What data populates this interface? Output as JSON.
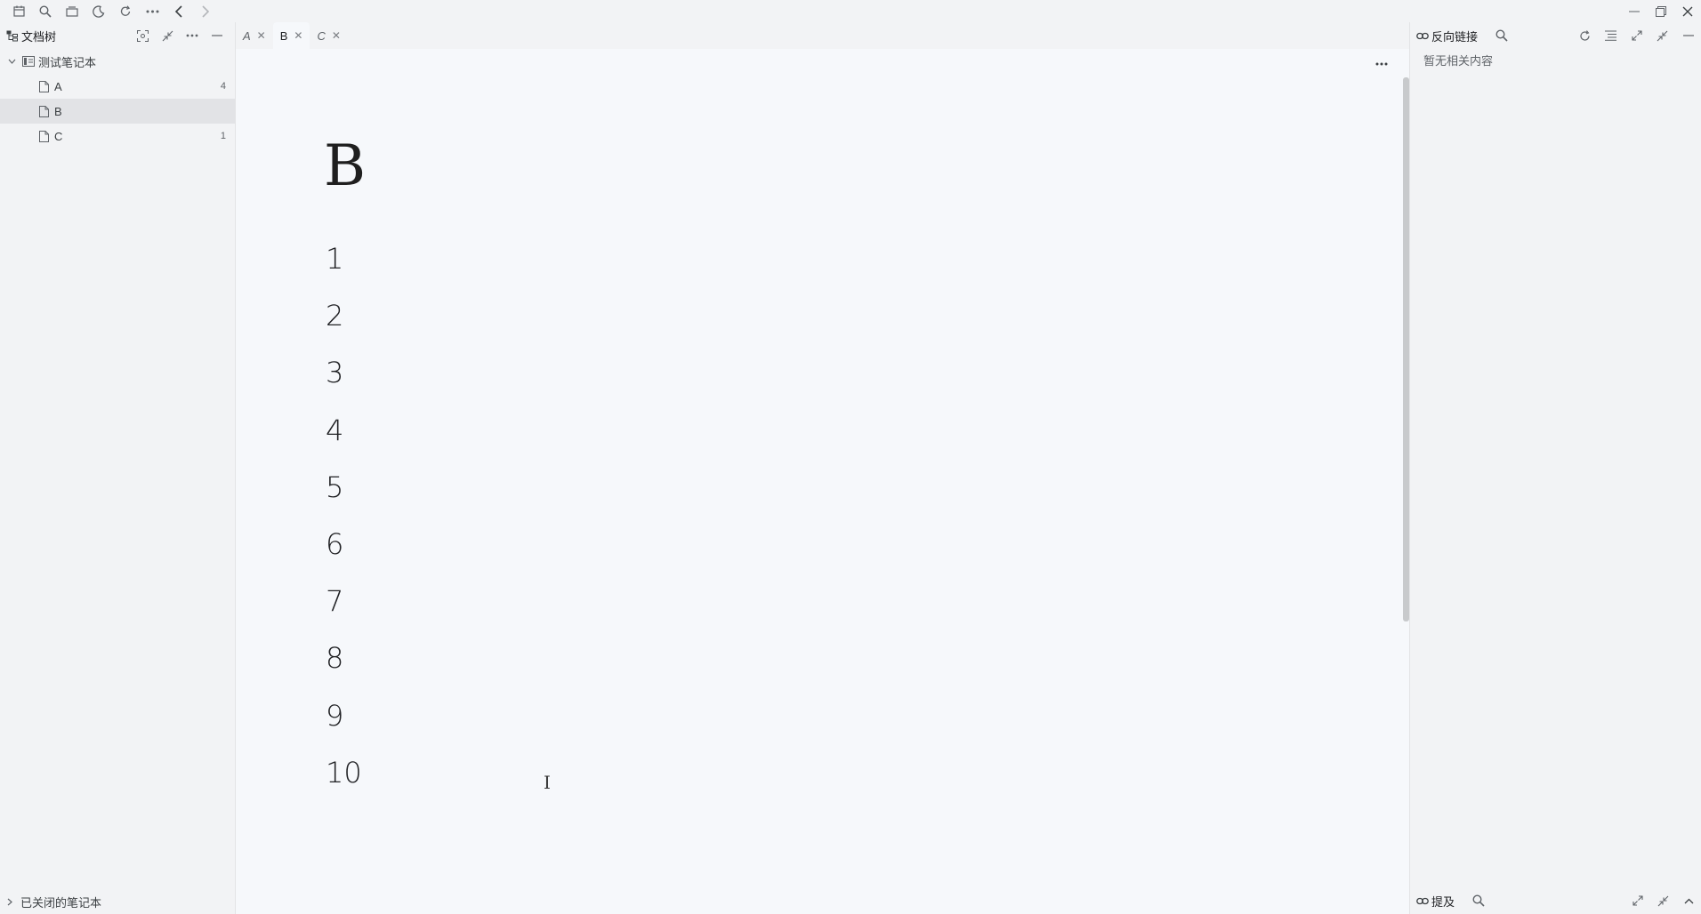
{
  "toolbar": {
    "left_icons": [
      "calendar-icon",
      "search-icon",
      "window-icon",
      "moon-icon",
      "sync-icon",
      "more-icon",
      "back-icon",
      "forward-icon"
    ],
    "right_icons": [
      "minimize-icon",
      "restore-icon",
      "close-icon"
    ]
  },
  "left_dock": {
    "title": "文档树",
    "notebook": {
      "name": "测试笔记本"
    },
    "docs": [
      {
        "name": "A",
        "count": "4"
      },
      {
        "name": "B",
        "count": ""
      },
      {
        "name": "C",
        "count": "1"
      }
    ],
    "closed_notebooks": "已关闭的笔记本"
  },
  "tabs": [
    {
      "label": "A"
    },
    {
      "label": "B"
    },
    {
      "label": "C"
    }
  ],
  "editor": {
    "title": "B",
    "paragraphs": [
      "1",
      "2",
      "3",
      "4",
      "5",
      "6",
      "7",
      "8",
      "9",
      "10"
    ]
  },
  "right_dock": {
    "backlinks_label": "反向链接",
    "empty_text": "暂无相关内容",
    "mentions_label": "提及"
  },
  "colors": {
    "background": "#f2f3f5",
    "editor_background": "#f6f8fb",
    "selected_row": "#e2e3e6"
  }
}
